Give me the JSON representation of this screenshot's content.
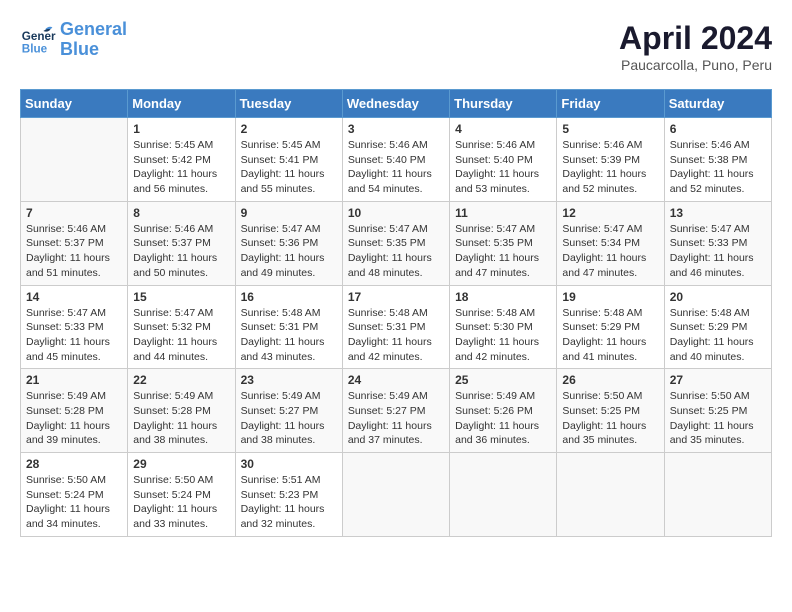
{
  "header": {
    "logo_line1": "General",
    "logo_line2": "Blue",
    "month_title": "April 2024",
    "location": "Paucarcolla, Puno, Peru"
  },
  "weekdays": [
    "Sunday",
    "Monday",
    "Tuesday",
    "Wednesday",
    "Thursday",
    "Friday",
    "Saturday"
  ],
  "weeks": [
    [
      {
        "day": "",
        "empty": true
      },
      {
        "day": "1",
        "sunrise": "5:45 AM",
        "sunset": "5:42 PM",
        "daylight": "11 hours and 56 minutes."
      },
      {
        "day": "2",
        "sunrise": "5:45 AM",
        "sunset": "5:41 PM",
        "daylight": "11 hours and 55 minutes."
      },
      {
        "day": "3",
        "sunrise": "5:46 AM",
        "sunset": "5:40 PM",
        "daylight": "11 hours and 54 minutes."
      },
      {
        "day": "4",
        "sunrise": "5:46 AM",
        "sunset": "5:40 PM",
        "daylight": "11 hours and 53 minutes."
      },
      {
        "day": "5",
        "sunrise": "5:46 AM",
        "sunset": "5:39 PM",
        "daylight": "11 hours and 52 minutes."
      },
      {
        "day": "6",
        "sunrise": "5:46 AM",
        "sunset": "5:38 PM",
        "daylight": "11 hours and 52 minutes."
      }
    ],
    [
      {
        "day": "7",
        "sunrise": "5:46 AM",
        "sunset": "5:37 PM",
        "daylight": "11 hours and 51 minutes."
      },
      {
        "day": "8",
        "sunrise": "5:46 AM",
        "sunset": "5:37 PM",
        "daylight": "11 hours and 50 minutes."
      },
      {
        "day": "9",
        "sunrise": "5:47 AM",
        "sunset": "5:36 PM",
        "daylight": "11 hours and 49 minutes."
      },
      {
        "day": "10",
        "sunrise": "5:47 AM",
        "sunset": "5:35 PM",
        "daylight": "11 hours and 48 minutes."
      },
      {
        "day": "11",
        "sunrise": "5:47 AM",
        "sunset": "5:35 PM",
        "daylight": "11 hours and 47 minutes."
      },
      {
        "day": "12",
        "sunrise": "5:47 AM",
        "sunset": "5:34 PM",
        "daylight": "11 hours and 47 minutes."
      },
      {
        "day": "13",
        "sunrise": "5:47 AM",
        "sunset": "5:33 PM",
        "daylight": "11 hours and 46 minutes."
      }
    ],
    [
      {
        "day": "14",
        "sunrise": "5:47 AM",
        "sunset": "5:33 PM",
        "daylight": "11 hours and 45 minutes."
      },
      {
        "day": "15",
        "sunrise": "5:47 AM",
        "sunset": "5:32 PM",
        "daylight": "11 hours and 44 minutes."
      },
      {
        "day": "16",
        "sunrise": "5:48 AM",
        "sunset": "5:31 PM",
        "daylight": "11 hours and 43 minutes."
      },
      {
        "day": "17",
        "sunrise": "5:48 AM",
        "sunset": "5:31 PM",
        "daylight": "11 hours and 42 minutes."
      },
      {
        "day": "18",
        "sunrise": "5:48 AM",
        "sunset": "5:30 PM",
        "daylight": "11 hours and 42 minutes."
      },
      {
        "day": "19",
        "sunrise": "5:48 AM",
        "sunset": "5:29 PM",
        "daylight": "11 hours and 41 minutes."
      },
      {
        "day": "20",
        "sunrise": "5:48 AM",
        "sunset": "5:29 PM",
        "daylight": "11 hours and 40 minutes."
      }
    ],
    [
      {
        "day": "21",
        "sunrise": "5:49 AM",
        "sunset": "5:28 PM",
        "daylight": "11 hours and 39 minutes."
      },
      {
        "day": "22",
        "sunrise": "5:49 AM",
        "sunset": "5:28 PM",
        "daylight": "11 hours and 38 minutes."
      },
      {
        "day": "23",
        "sunrise": "5:49 AM",
        "sunset": "5:27 PM",
        "daylight": "11 hours and 38 minutes."
      },
      {
        "day": "24",
        "sunrise": "5:49 AM",
        "sunset": "5:27 PM",
        "daylight": "11 hours and 37 minutes."
      },
      {
        "day": "25",
        "sunrise": "5:49 AM",
        "sunset": "5:26 PM",
        "daylight": "11 hours and 36 minutes."
      },
      {
        "day": "26",
        "sunrise": "5:50 AM",
        "sunset": "5:25 PM",
        "daylight": "11 hours and 35 minutes."
      },
      {
        "day": "27",
        "sunrise": "5:50 AM",
        "sunset": "5:25 PM",
        "daylight": "11 hours and 35 minutes."
      }
    ],
    [
      {
        "day": "28",
        "sunrise": "5:50 AM",
        "sunset": "5:24 PM",
        "daylight": "11 hours and 34 minutes."
      },
      {
        "day": "29",
        "sunrise": "5:50 AM",
        "sunset": "5:24 PM",
        "daylight": "11 hours and 33 minutes."
      },
      {
        "day": "30",
        "sunrise": "5:51 AM",
        "sunset": "5:23 PM",
        "daylight": "11 hours and 32 minutes."
      },
      {
        "day": "",
        "empty": true
      },
      {
        "day": "",
        "empty": true
      },
      {
        "day": "",
        "empty": true
      },
      {
        "day": "",
        "empty": true
      }
    ]
  ],
  "labels": {
    "sunrise_prefix": "Sunrise: ",
    "sunset_prefix": "Sunset: ",
    "daylight_prefix": "Daylight: "
  }
}
